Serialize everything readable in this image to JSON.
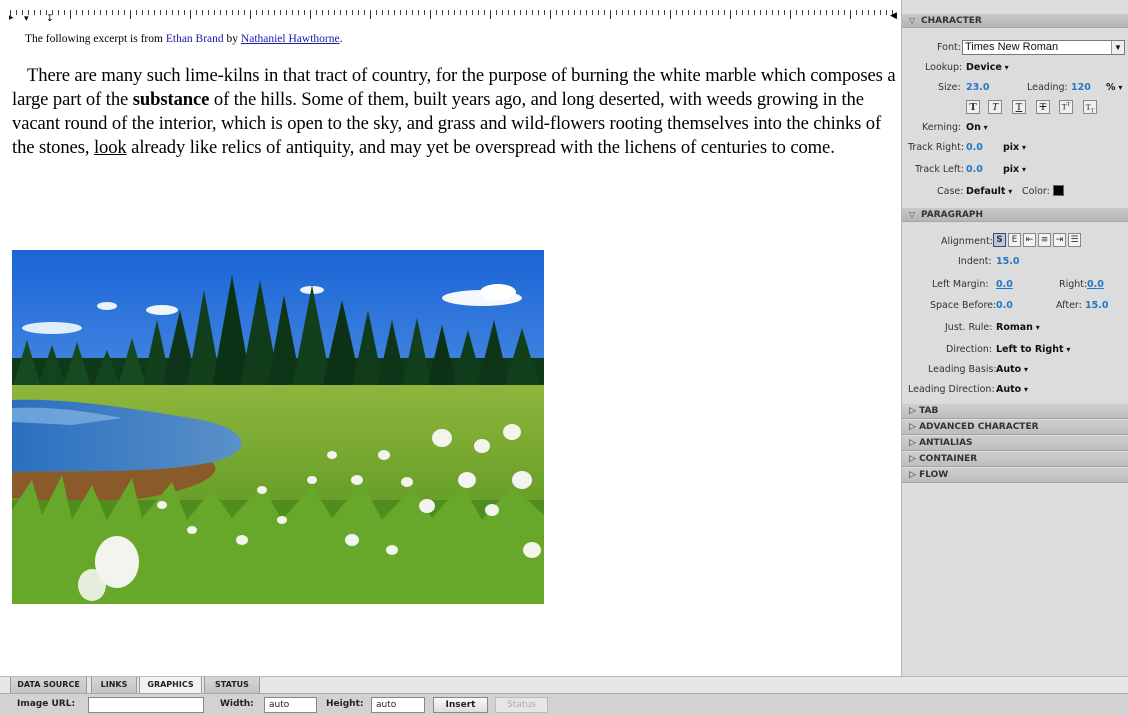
{
  "editor": {
    "excerpt": {
      "prefix": "The following excerpt is from ",
      "book_title": "Ethan Brand",
      "by": " by ",
      "author": "Nathaniel Hawthorne",
      "suffix": "."
    },
    "paragraph": {
      "part1": "There are many such lime-kilns in that tract of country, for the purpose of burning the white marble which composes a large part of the ",
      "bold": "substance",
      "part2": " of the hills. Some of them, built years ago, and long deserted, with weeds growing in the vacant round of the interior, which is open to the sky, and grass and wild-flowers rooting themselves into the chinks of the stones, ",
      "underlined": "look",
      "part3": " already like relics of antiquity, and may yet be overspread with the lichens of centuries to come."
    }
  },
  "panel": {
    "character": {
      "title": "CHARACTER",
      "font_label": "Font:",
      "font_value": "Times New Roman",
      "lookup_label": "Lookup:",
      "lookup_value": "Device",
      "size_label": "Size:",
      "size_value": "23.0",
      "leading_label": "Leading:",
      "leading_value": "120",
      "leading_unit": "%",
      "style_buttons": [
        "T",
        "T",
        "T",
        "T",
        "T",
        "T"
      ],
      "kerning_label": "Kerning:",
      "kerning_value": "On",
      "track_right_label": "Track Right:",
      "track_right_value": "0.0",
      "track_right_unit": "pix",
      "track_left_label": "Track Left:",
      "track_left_value": "0.0",
      "track_left_unit": "pix",
      "case_label": "Case:",
      "case_value": "Default",
      "color_label": "Color:",
      "color_value": "#000000"
    },
    "paragraph": {
      "title": "PARAGRAPH",
      "alignment_label": "Alignment:",
      "alignment_buttons": [
        "S",
        "E",
        "",
        "",
        "",
        ""
      ],
      "indent_label": "Indent:",
      "indent_value": "15.0",
      "left_margin_label": "Left Margin:",
      "left_margin_value": "0.0",
      "right_label": "Right:",
      "right_value": "0.0",
      "space_before_label": "Space Before:",
      "space_before_value": "0.0",
      "after_label": "After:",
      "after_value": "15.0",
      "just_rule_label": "Just. Rule:",
      "just_rule_value": "Roman",
      "direction_label": "Direction:",
      "direction_value": "Left to Right",
      "leading_basis_label": "Leading Basis:",
      "leading_basis_value": "Auto",
      "leading_direction_label": "Leading Direction:",
      "leading_direction_value": "Auto"
    },
    "collapsed_sections": [
      "TAB",
      "ADVANCED CHARACTER",
      "ANTIALIAS",
      "CONTAINER",
      "FLOW"
    ]
  },
  "tabs": [
    "DATA SOURCE",
    "LINKS",
    "GRAPHICS",
    "STATUS"
  ],
  "active_tab": "GRAPHICS",
  "toolbar": {
    "image_url_label": "Image URL:",
    "image_url_value": "",
    "width_label": "Width:",
    "width_value": "auto",
    "height_label": "Height:",
    "height_value": "auto",
    "insert_label": "Insert",
    "status_label": "Status"
  },
  "colors": {
    "panel_bg": "#dcdcdc",
    "value_blue": "#2178c8",
    "link_blue": "#1a1aa8"
  }
}
